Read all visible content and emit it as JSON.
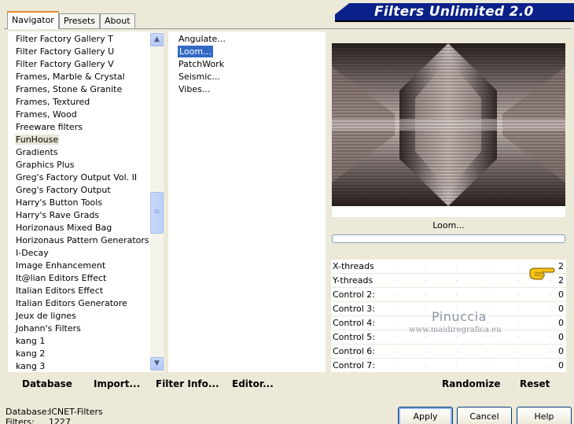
{
  "tabs": [
    "Navigator",
    "Presets",
    "About"
  ],
  "app_title": "Filters Unlimited 2.0",
  "categories": [
    "Filter Factory Gallery T",
    "Filter Factory Gallery U",
    "Filter Factory Gallery V",
    "Frames, Marble & Crystal",
    "Frames, Stone & Granite",
    "Frames, Textured",
    "Frames, Wood",
    "Freeware filters",
    "FunHouse",
    "Gradients",
    "Graphics Plus",
    "Greg's Factory Output Vol. II",
    "Greg's Factory Output",
    "Harry's Button Tools",
    "Harry's Rave Grads",
    "Horizonaus Mixed Bag",
    "Horizonaus Pattern Generators",
    "I-Decay",
    "Image Enhancement",
    "It@lian Editors Effect",
    "Italian Editors Effect",
    "Italian Editors Generatore",
    "Jeux de lignes",
    "Johann's Filters",
    "kang 1",
    "kang 2",
    "kang 3"
  ],
  "selected_category": "FunHouse",
  "filters": [
    "Angulate...",
    "Loom...",
    "PatchWork",
    "Seismic...",
    "Vibes..."
  ],
  "selected_filter": "Loom...",
  "preview_filter_name": "Loom...",
  "controls": [
    {
      "label": "X-threads",
      "value": "2"
    },
    {
      "label": "Y-threads",
      "value": "2"
    },
    {
      "label": "Control 2:",
      "value": "0"
    },
    {
      "label": "Control 3:",
      "value": "0"
    },
    {
      "label": "Control 4:",
      "value": "0"
    },
    {
      "label": "Control 5:",
      "value": "0"
    },
    {
      "label": "Control 6:",
      "value": "0"
    },
    {
      "label": "Control 7:",
      "value": "0"
    }
  ],
  "watermark": {
    "name": "Pinuccia",
    "url": "www.maidiregrafica.eu"
  },
  "toolbar": {
    "database": "Database",
    "import": "Import...",
    "filter_info": "Filter Info...",
    "editor": "Editor...",
    "randomize": "Randomize",
    "reset": "Reset"
  },
  "status": {
    "database_label": "Database:",
    "database_value": "ICNET-Filters",
    "filters_label": "Filters:",
    "filters_value": "1227"
  },
  "buttons": {
    "apply": "Apply",
    "cancel": "Cancel",
    "help": "Help"
  },
  "colors": {
    "banner": "#0a2189",
    "selection": "#316ac5",
    "tab_accent": "#e68b2c"
  },
  "icons": {
    "pointer": "pointing-hand-icon",
    "scroll_up": "scroll-up-icon",
    "scroll_down": "scroll-down-icon"
  }
}
